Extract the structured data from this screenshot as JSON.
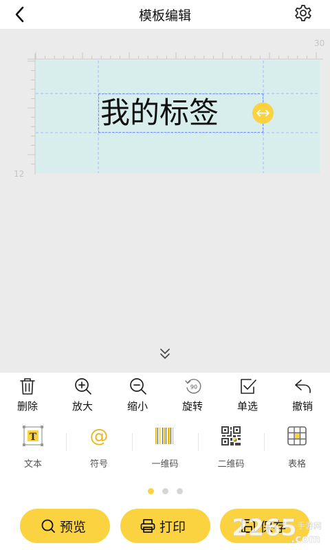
{
  "header": {
    "title": "模板编辑",
    "back_icon": "chevron-left-icon",
    "settings_icon": "gear-icon"
  },
  "canvas": {
    "ruler_top_end": "30",
    "ruler_left_end": "12",
    "label_text": "我的标签"
  },
  "tools": [
    {
      "label": "删除",
      "icon": "trash-icon"
    },
    {
      "label": "放大",
      "icon": "zoom-in-icon"
    },
    {
      "label": "缩小",
      "icon": "zoom-out-icon"
    },
    {
      "label": "旋转",
      "icon": "rotate-90-icon",
      "badge": "90"
    },
    {
      "label": "单选",
      "icon": "checkbox-icon"
    },
    {
      "label": "撤销",
      "icon": "undo-icon"
    }
  ],
  "elements": [
    {
      "label": "文本",
      "icon": "text-icon",
      "glyph": "T"
    },
    {
      "label": "符号",
      "icon": "at-symbol-icon",
      "glyph": "@"
    },
    {
      "label": "一维码",
      "icon": "barcode-icon"
    },
    {
      "label": "二维码",
      "icon": "qrcode-icon"
    },
    {
      "label": "表格",
      "icon": "table-icon"
    }
  ],
  "pagination": {
    "pages": 3,
    "active": 1
  },
  "actions": {
    "preview_label": "预览",
    "print_label": "打印",
    "save_label": "保存"
  },
  "watermark": {
    "brand": "2265",
    "suffix": ".com",
    "tagline": "手游网"
  },
  "colors": {
    "accent": "#fbd341",
    "label_background": "#d8eeec",
    "canvas_background": "#ebebeb",
    "selection_border": "#6f8fff"
  }
}
